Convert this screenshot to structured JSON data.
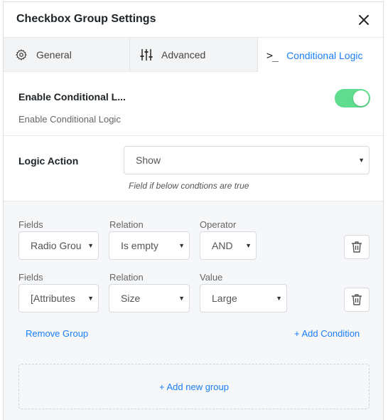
{
  "dialog": {
    "title": "Checkbox Group Settings"
  },
  "tabs": [
    {
      "label": "General",
      "icon": "gear-icon"
    },
    {
      "label": "Advanced",
      "icon": "sliders-icon"
    },
    {
      "label": "Conditional Logic",
      "icon": "terminal-icon",
      "active": true
    }
  ],
  "enable": {
    "label": "Enable Conditional L...",
    "help": "Enable Conditional Logic",
    "toggle_on": true,
    "toggle_color": "#5fdc8d"
  },
  "logic_action": {
    "label": "Logic Action",
    "value": "Show",
    "hint": "Field if below condtions are true"
  },
  "conditions": [
    {
      "field_label": "Fields",
      "field_value": "Radio Grou",
      "relation_label": "Relation",
      "relation_value": "Is empty",
      "third_label": "Operator",
      "third_value": "AND"
    },
    {
      "field_label": "Fields",
      "field_value": "[Attributes",
      "relation_label": "Relation",
      "relation_value": "Size",
      "third_label": "Value",
      "third_value": "Large"
    }
  ],
  "actions": {
    "remove_group": "Remove Group",
    "add_condition": "+ Add Condition",
    "add_group": "+ Add new group"
  },
  "colors": {
    "accent": "#1a7efb",
    "toggle": "#5fdc8d"
  }
}
